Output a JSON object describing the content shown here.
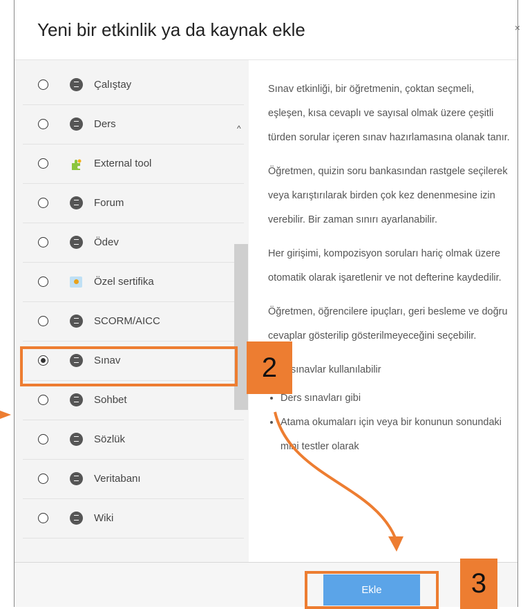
{
  "dialog": {
    "title": "Yeni bir etkinlik ya da kaynak ekle",
    "close_glyph": "×"
  },
  "items": [
    {
      "label": "Çalıştay",
      "icon": "workshop-icon",
      "selected": false
    },
    {
      "label": "Ders",
      "icon": "lesson-icon",
      "selected": false
    },
    {
      "label": "External tool",
      "icon": "puzzle-icon",
      "selected": false
    },
    {
      "label": "Forum",
      "icon": "forum-icon",
      "selected": false
    },
    {
      "label": "Ödev",
      "icon": "assignment-icon",
      "selected": false
    },
    {
      "label": "Özel sertifika",
      "icon": "certificate-icon",
      "selected": false
    },
    {
      "label": "SCORM/AICC",
      "icon": "scorm-icon",
      "selected": false
    },
    {
      "label": "Sınav",
      "icon": "quiz-icon",
      "selected": true
    },
    {
      "label": "Sohbet",
      "icon": "chat-icon",
      "selected": false
    },
    {
      "label": "Sözlük",
      "icon": "glossary-icon",
      "selected": false
    },
    {
      "label": "Veritabanı",
      "icon": "database-icon",
      "selected": false
    },
    {
      "label": "Wiki",
      "icon": "wiki-icon",
      "selected": false
    }
  ],
  "description": {
    "paragraphs": [
      "Sınav etkinliği, bir öğretmenin, çoktan seçmeli, eşleşen, kısa cevaplı ve sayısal olmak üzere çeşitli türden sorular içeren sınav hazırlamasına olanak tanır.",
      "Öğretmen, quizin soru bankasından rastgele seçilerek veya karıştırılarak birden çok kez denenmesine izin verebilir. Bir zaman sınırı ayarlanabilir.",
      "Her girişimi, kompozisyon soruları hariç olmak üzere otomatik olarak işaretlenir ve not defterine kaydedilir.",
      "Öğretmen, öğrencilere ipuçları, geri besleme ve doğru cevaplar gösterilip gösterilmeyeceğini seçebilir.",
      "Kısa sınavlar kullanılabilir"
    ],
    "bullets": [
      "Ders sınavları gibi",
      "Atama okumaları için veya bir konunun sonundaki mini testler olarak"
    ]
  },
  "footer": {
    "add_label": "Ekle"
  },
  "annotations": {
    "callout_2": "2",
    "callout_3": "3",
    "accent_color": "#ed7d31"
  },
  "colors": {
    "button": "#5ba4e8",
    "list_bg": "#f4f4f4"
  }
}
